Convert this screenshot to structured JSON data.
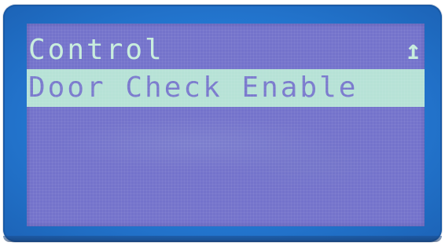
{
  "display": {
    "title": "Control",
    "back_icon": "up-arrow-icon",
    "back_glyph": "↥",
    "menu_items": [
      {
        "label": "Door Check Enable",
        "selected": true
      }
    ]
  },
  "colors": {
    "bezel": "#2478d2",
    "screen_background": "#7473cb",
    "text": "#c7eddc",
    "highlight_bar": "#b6e2d6",
    "highlight_text": "#7a7acd"
  }
}
